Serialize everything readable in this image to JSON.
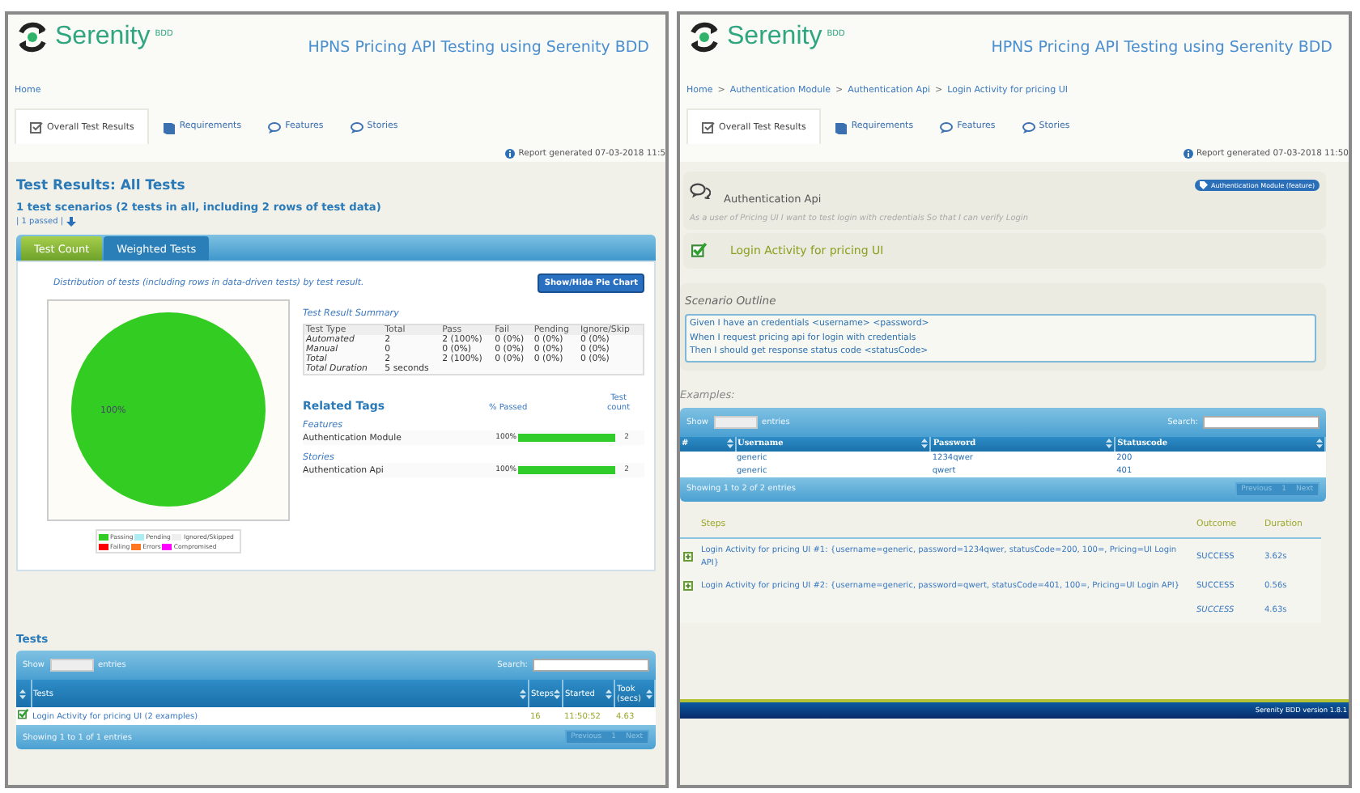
{
  "left_report": {
    "header": {
      "logo": "Serenity",
      "logo_suffix": "BDD",
      "title": "HPNS Pricing API Testing using Serenity BDD"
    },
    "breadcrumb": [
      {
        "label": "Home",
        "kind": "link"
      }
    ],
    "tabs": [
      {
        "label": "Overall Test Results",
        "kind": "overview",
        "selected": true
      },
      {
        "label": "Requirements",
        "kind": "requirements",
        "selected": false
      },
      {
        "label": "Features",
        "kind": "features",
        "selected": false
      },
      {
        "label": "Stories",
        "kind": "stories",
        "selected": false
      }
    ],
    "report_generated": "Report generated 07-03-2018 11:5",
    "heading": "Test Results: All Tests",
    "summary": "1 test scenarios (2 tests in all, including 2 rows of test data)",
    "passed": "| 1 passed |",
    "subtabs": [
      {
        "label": "Test Count",
        "selected": true
      },
      {
        "label": "Weighted Tests",
        "selected": false
      }
    ],
    "distribution_note": "Distribution of tests (including rows in data-driven tests) by test result.",
    "pie_button": "Show/Hide Pie Chart",
    "chart_data": {
      "type": "pie",
      "values": [
        100
      ],
      "value_labels": [
        "100%"
      ]
    },
    "legend": [
      {
        "label": "Passing",
        "color": "#33cc22"
      },
      {
        "label": "Pending",
        "color": "#aaeef4"
      },
      {
        "label": "Ignored/Skipped",
        "color": "#eeeeee"
      },
      {
        "label": "Failing",
        "color": "#ff0000"
      },
      {
        "label": "Errors",
        "color": "#ff7722"
      },
      {
        "label": "Compromised",
        "color": "#ff00ff"
      }
    ],
    "result_summary": {
      "title": "Test Result Summary",
      "columns": [
        "Test Type",
        "Total",
        "Pass",
        "Fail",
        "Pending",
        "Ignore/Skip"
      ],
      "rows": [
        [
          "Automated",
          "2",
          "2 (100%)",
          "0 (0%)",
          "0 (0%)",
          "0 (0%)"
        ],
        [
          "Manual",
          "0",
          "0 (0%)",
          "0 (0%)",
          "0 (0%)",
          "0 (0%)"
        ],
        [
          "Total",
          "2",
          "2 (100%)",
          "0 (0%)",
          "0 (0%)",
          "0 (0%)"
        ],
        [
          "Total Duration",
          "5 seconds",
          "",
          "",
          "",
          ""
        ]
      ]
    },
    "related_tags": {
      "title": "Related Tags",
      "passed_header": "% Passed",
      "count_header": "Test count",
      "groups": [
        {
          "name": "Features",
          "tags": [
            {
              "label": "Authentication Module",
              "percent": "100%",
              "level": 1,
              "count": "2"
            }
          ]
        },
        {
          "name": "Stories",
          "tags": [
            {
              "label": "Authentication Api",
              "percent": "100%",
              "level": 1,
              "count": "2"
            }
          ]
        }
      ]
    },
    "tests": {
      "title": "Tests",
      "show_label": "Show",
      "entries_label": "entries",
      "search_label": "Search:",
      "columns": [
        "Tests",
        "Steps",
        "Started",
        "Took (secs)"
      ],
      "rows": [
        {
          "passed": true,
          "title": "Login Activity for pricing UI (2 examples)",
          "steps": "16",
          "started": "11:50:52",
          "took": "4.63"
        }
      ],
      "info": "Showing 1 to 1 of 1 entries",
      "pager": [
        "Previous",
        "1",
        "Next"
      ]
    }
  },
  "right_report": {
    "header": {
      "logo": "Serenity",
      "logo_suffix": "BDD",
      "title": "HPNS Pricing API Testing using Serenity BDD"
    },
    "breadcrumb": [
      {
        "label": "Home",
        "kind": "link"
      },
      {
        "label": ">",
        "kind": "separator"
      },
      {
        "label": "Authentication Module",
        "kind": "link"
      },
      {
        "label": ">",
        "kind": "separator"
      },
      {
        "label": "Authentication Api",
        "kind": "link"
      },
      {
        "label": ">",
        "kind": "separator"
      },
      {
        "label": "Login Activity for pricing UI",
        "kind": "link"
      }
    ],
    "tabs": [
      {
        "label": "Overall Test Results",
        "kind": "overview",
        "selected": true
      },
      {
        "label": "Requirements",
        "kind": "requirements",
        "selected": false
      },
      {
        "label": "Features",
        "kind": "features",
        "selected": false
      },
      {
        "label": "Stories",
        "kind": "stories",
        "selected": false
      }
    ],
    "report_generated": "Report generated 07-03-2018 11:50",
    "story": {
      "title": "Authentication Api",
      "tag": "Authentication Module (feature)",
      "narrative": "As a user of Pricing UI I want to test login with credentials So that I can verify Login"
    },
    "scenario": {
      "title": "Login Activity for pricing UI",
      "passed": true
    },
    "outline": {
      "title": "Scenario Outline",
      "steps": [
        "Given I have an credentials <username> <password>",
        "When I request pricing api for login with credentials",
        "Then I should get response status code <statusCode>"
      ]
    },
    "examples": {
      "title": "Examples:",
      "show_label": "Show",
      "entries_label": "entries",
      "search_label": "Search:",
      "columns": [
        "#",
        "Username",
        "Password",
        "Statuscode"
      ],
      "rows": [
        [
          "",
          "generic",
          "1234qwer",
          "200"
        ],
        [
          "",
          "generic",
          "qwert",
          "401"
        ]
      ],
      "info": "Showing 1 to 2 of 2 entries",
      "pager": [
        "Previous",
        "1",
        "Next"
      ]
    },
    "steps": {
      "columns": [
        "Steps",
        "Outcome",
        "Duration"
      ],
      "rows": [
        {
          "kind": "step",
          "text": "Login Activity for pricing UI #1: {username=generic, password=1234qwer, statusCode=200, 100=, Pricing=UI Login API}",
          "outcome": "SUCCESS",
          "duration": "3.62s"
        },
        {
          "kind": "step",
          "text": "Login Activity for pricing UI #2: {username=generic, password=qwert, statusCode=401, 100=, Pricing=UI Login API}",
          "outcome": "SUCCESS",
          "duration": "0.56s"
        },
        {
          "kind": "total",
          "outcome": "SUCCESS",
          "duration": "4.63s"
        }
      ]
    },
    "footer": "Serenity BDD version 1.8.1"
  }
}
